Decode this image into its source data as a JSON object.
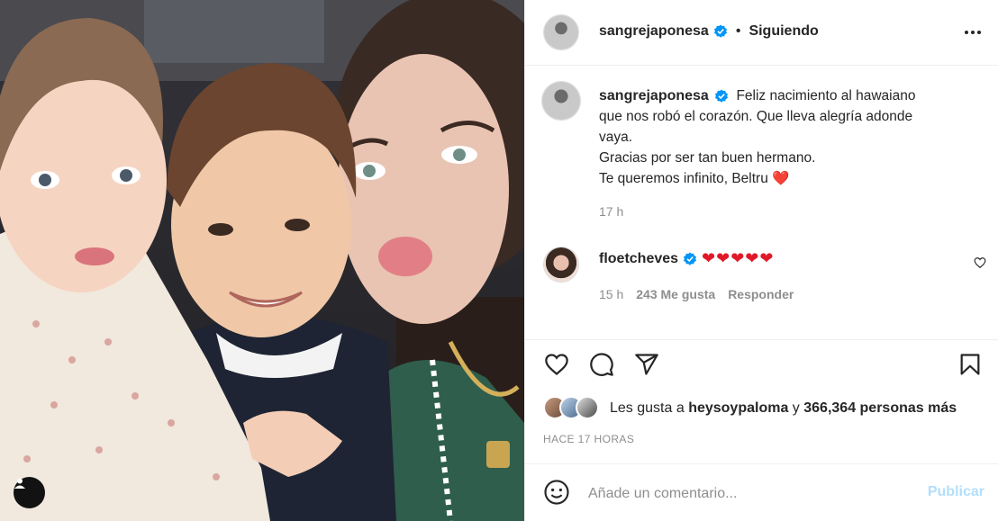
{
  "post": {
    "photo_alt": "photo",
    "tag_icon": "user-tag-icon"
  },
  "header": {
    "username": "sangrejaponesa",
    "separator": "•",
    "follow_status": "Siguiendo",
    "more_icon": "more-options-icon"
  },
  "caption": {
    "username": "sangrejaponesa",
    "lines": [
      "Feliz nacimiento al hawaiano",
      "que nos robó el corazón. Que lleva alegría adonde",
      "vaya.",
      "Gracias por ser tan buen hermano.",
      "Te queremos infinito, Beltru"
    ],
    "heart_emoji": "❤️",
    "time": "17 h"
  },
  "comment": {
    "username": "floetcheves",
    "text": "❤❤❤❤❤",
    "time": "15 h",
    "likes": "243 Me gusta",
    "reply": "Responder"
  },
  "likes": {
    "prefix": "Les gusta a",
    "user": "heysoypaloma",
    "conj": "y",
    "others": "366,364 personas más"
  },
  "timeago": "HACE 17 HORAS",
  "add_comment": {
    "placeholder": "Añade un comentario...",
    "publish": "Publicar"
  },
  "colors": {
    "verified": "#0095f6",
    "heart": "#e0192a",
    "publish_disabled": "#b2dffc",
    "muted": "#8e8e8e"
  }
}
